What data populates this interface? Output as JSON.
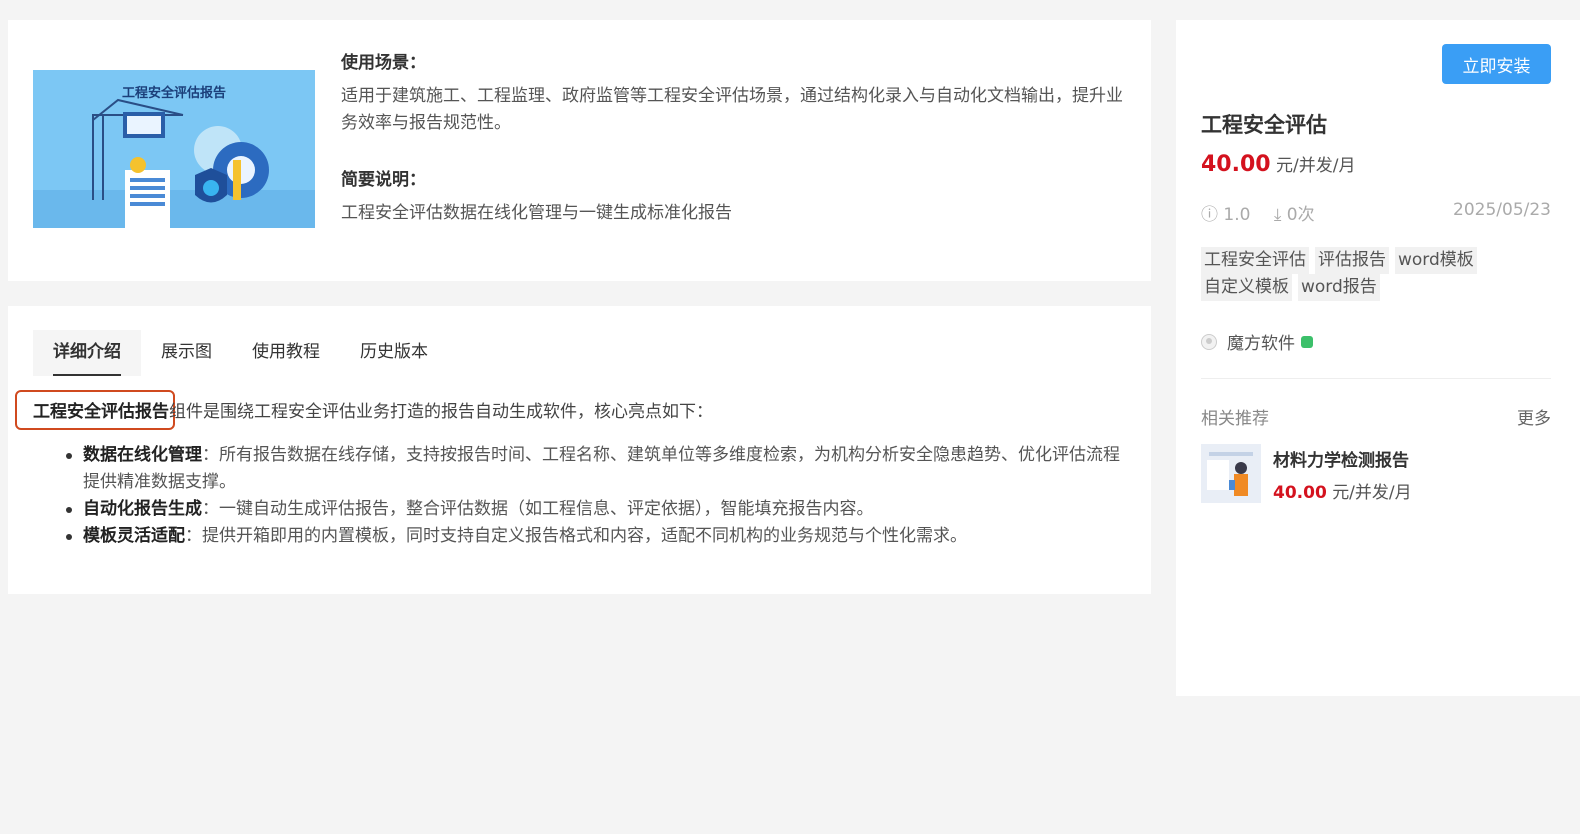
{
  "product": {
    "cover_title": "工程安全评估报告",
    "usage_heading": "使用场景：",
    "usage_text": "适用于建筑施工、工程监理、政府监管等工程安全评估场景，通过结构化录入与自动化文档输出，提升业务效率与报告规范性。",
    "summary_heading": "简要说明：",
    "summary_text": "工程安全评估数据在线化管理与一键生成标准化报告"
  },
  "tabs": [
    {
      "label": "详细介绍",
      "active": true
    },
    {
      "label": "展示图"
    },
    {
      "label": "使用教程"
    },
    {
      "label": "历史版本"
    }
  ],
  "detail": {
    "intro_bold": "工程安全评估报告",
    "intro_rest": "组件是围绕工程安全评估业务打造的报告自动生成软件，核心亮点如下：",
    "features": [
      {
        "title": "数据在线化管理",
        "text": "：所有报告数据在线存储，支持按报告时间、工程名称、建筑单位等多维度检索，为机构分析安全隐患趋势、优化评估流程提供精准数据支撑。"
      },
      {
        "title": "自动化报告生成",
        "text": "：一键自动生成评估报告，整合评估数据（如工程信息、评定依据），智能填充报告内容。"
      },
      {
        "title": "模板灵活适配",
        "text": "：提供开箱即用的内置模板，同时支持自定义报告格式和内容，适配不同机构的业务规范与个性化需求。"
      }
    ]
  },
  "sidebar": {
    "install_label": "立即安装",
    "name": "工程安全评估",
    "price": "40.00",
    "price_unit": "元/并发/月",
    "version": "1.0",
    "downloads": "0次",
    "date": "2025/05/23",
    "tags": [
      "工程安全评估",
      "评估报告",
      "word模板",
      "自定义模板",
      "word报告"
    ],
    "author": "魔方软件",
    "related_title": "相关推荐",
    "more_label": "更多",
    "related": {
      "name": "材料力学检测报告",
      "price": "40.00",
      "price_unit": "元/并发/月"
    }
  },
  "colors": {
    "accent": "#3a9ef5",
    "price": "#d4121e",
    "highlight_border": "#d04a1f",
    "verified": "#3cc06a"
  },
  "icons": [
    "info-icon",
    "download-icon",
    "avatar-icon",
    "verified-icon"
  ]
}
